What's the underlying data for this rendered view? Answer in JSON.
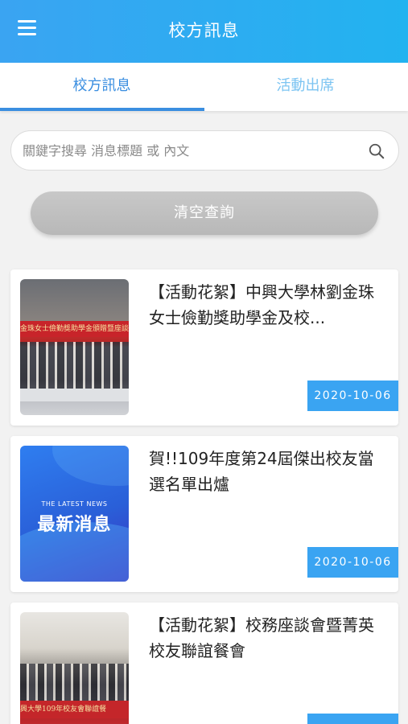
{
  "app_bar": {
    "title": "校方訊息",
    "menu_icon": "hamburger-menu-icon",
    "colors": {
      "start": "#3aa4f2",
      "end": "#22b3f0"
    }
  },
  "tabs": [
    {
      "label": "校方訊息",
      "active": true
    },
    {
      "label": "活動出席",
      "active": false
    }
  ],
  "search": {
    "placeholder": "關鍵字搜尋 消息標題 或 內文",
    "value": "",
    "icon": "search-icon"
  },
  "clear_button": {
    "label": "清空查詢"
  },
  "news": [
    {
      "title": "【活動花絮】中興大學林劉金珠女士儉勤獎助學金及校...",
      "date": "2020-10-06",
      "image_banner_text": "金珠女士儉勤獎助學金頒贈暨座談"
    },
    {
      "title": "賀!!109年度第24屆傑出校友當選名單出爐",
      "date": "2020-10-06",
      "image_small_text": "THE LATEST NEWS",
      "image_big_text": "最新消息"
    },
    {
      "title": "【活動花絮】校務座談會暨菁英校友聯誼餐會",
      "date": "",
      "image_banner_text": "興大學109年校友會聯誼餐"
    }
  ],
  "accent_color": "#3a8ee0"
}
